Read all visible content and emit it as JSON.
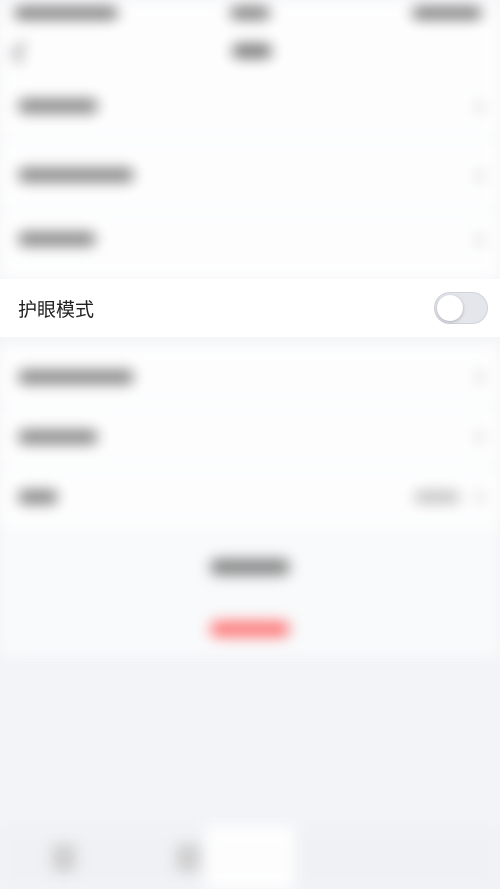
{
  "setting": {
    "label": "护眼模式",
    "toggle_on": false
  },
  "colors": {
    "page_background": "#f3f4f7",
    "row_background": "#ffffff",
    "danger": "#ff6b6b",
    "toggle_track_off": "#e4e6ec"
  }
}
